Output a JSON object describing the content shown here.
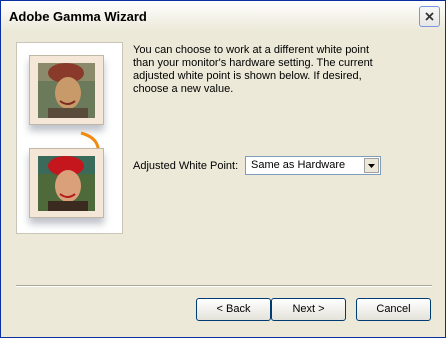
{
  "window": {
    "title": "Adobe Gamma Wizard",
    "close_icon": "close-icon"
  },
  "content": {
    "description": "You can choose to work at a different white point\nthan your monitor's hardware setting. The current\nadjusted white point is shown below. If desired,\nchoose a new value.",
    "white_point_label": "Adjusted White Point:",
    "white_point_value": "Same as Hardware"
  },
  "buttons": {
    "back": "< Back",
    "next": "Next >",
    "cancel": "Cancel"
  },
  "icons": [
    "close-icon",
    "chevron-down-icon",
    "curved-arrow-icon"
  ],
  "colors": {
    "title_bar_border": "#0b2f9e",
    "dialog_background": "#ece9d8",
    "arrow_orange": "#f08a10"
  }
}
